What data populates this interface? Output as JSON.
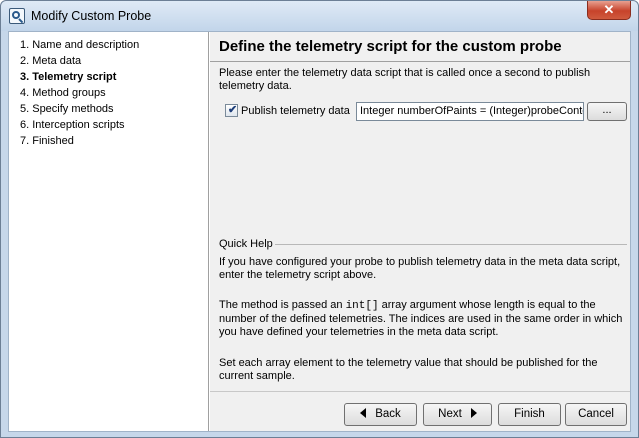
{
  "window": {
    "title": "Modify Custom Probe",
    "icon": "probe-magnifier-icon",
    "close_label": "✕"
  },
  "steps": [
    {
      "label": "1. Name and description",
      "active": false
    },
    {
      "label": "2. Meta data",
      "active": false
    },
    {
      "label": "3. Telemetry script",
      "active": true
    },
    {
      "label": "4. Method groups",
      "active": false
    },
    {
      "label": "5. Specify methods",
      "active": false
    },
    {
      "label": "6. Interception scripts",
      "active": false
    },
    {
      "label": "7. Finished",
      "active": false
    }
  ],
  "main": {
    "title": "Define the telemetry script for the custom probe",
    "intro_line1": "Please enter the telemetry data script that is called once a second to publish",
    "intro_line2": "telemetry data.",
    "publish_checkbox_label": "Publish telemetry data",
    "publish_checked": true,
    "script_value": "Integer numberOfPaints = (Integer)probeContext.getMap().get(\"paints\");",
    "edit_button_label": "..."
  },
  "quick_help": {
    "heading": "Quick Help",
    "p1_line1": "If you have configured your probe to publish telemetry data in the meta data script,",
    "p1_line2": "enter the telemetry script above.",
    "p2_line1_before": "The method is passed an ",
    "p2_code": "int[]",
    "p2_line1_after": " array argument whose length is equal to the",
    "p2_line2": "number of the defined telemetries. The indices are used in the same order in which",
    "p2_line3": "you have defined your telemetries in the meta data script.",
    "p3_line1": "Set each array element to the telemetry value that should be published for the",
    "p3_line2": "current sample."
  },
  "buttons": {
    "back": "Back",
    "next": "Next",
    "finish": "Finish",
    "cancel": "Cancel"
  }
}
